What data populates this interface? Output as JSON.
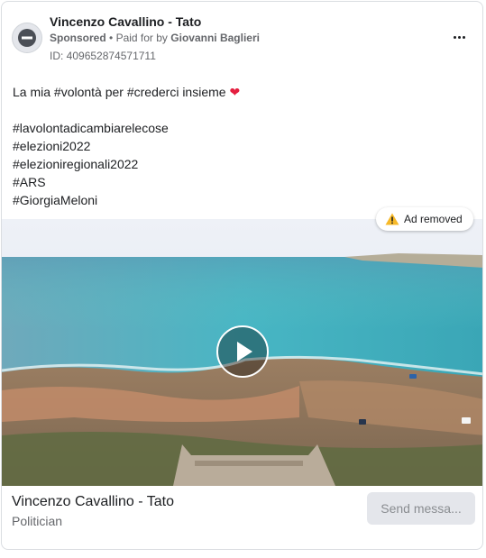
{
  "header": {
    "page_name": "Vincenzo Cavallino - Tato",
    "sponsored": "Sponsored",
    "separator": "•",
    "paid_for_prefix": "Paid for by",
    "paid_for_name": "Giovanni Baglieri",
    "ad_id": "ID: 409652874571711",
    "avatar_icon": "blocked-avatar-icon",
    "more_icon": "more-options-icon"
  },
  "post": {
    "lines": [
      "La mia #volontà per #crederci insieme",
      "",
      "#lavolontadicambiarelecose",
      "#elezioni2022",
      "#elezioniregionali2022",
      "#ARS",
      "#GiorgiaMeloni"
    ],
    "heart": "❤"
  },
  "media": {
    "badge_label": "Ad removed",
    "badge_icon": "warning-icon",
    "play_icon": "play-icon"
  },
  "footer": {
    "title": "Vincenzo Cavallino - Tato",
    "subtitle": "Politician",
    "cta_label": "Send messa..."
  },
  "colors": {
    "heart": "#e41e3f",
    "warning": "#f7b928",
    "muted_text": "#65676b",
    "cta_bg": "#e4e6eb"
  }
}
